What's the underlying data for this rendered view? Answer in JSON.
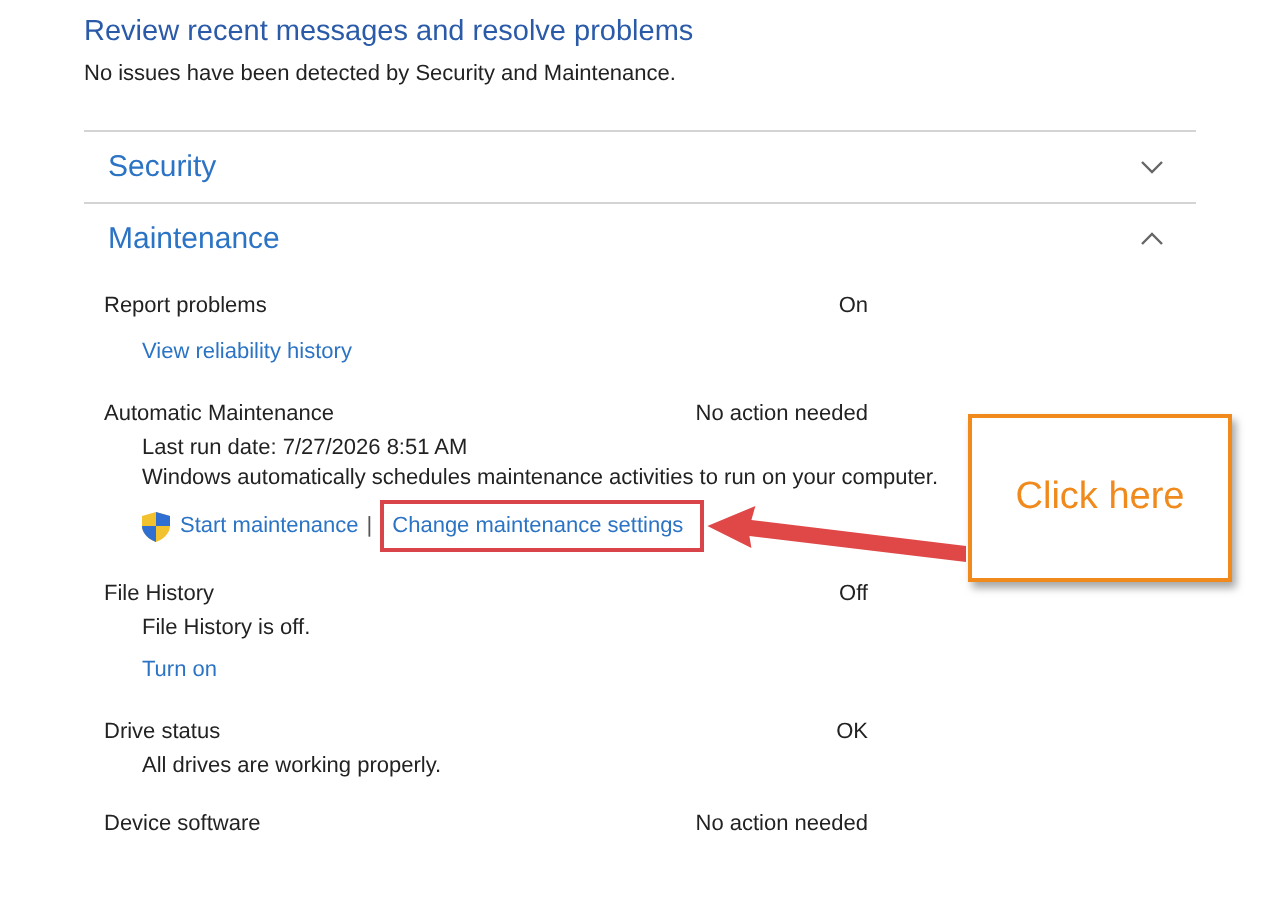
{
  "header": {
    "title": "Review recent messages and resolve problems",
    "subtitle": "No issues have been detected by Security and Maintenance."
  },
  "sections": [
    {
      "title": "Security",
      "expanded": false
    },
    {
      "title": "Maintenance",
      "expanded": true,
      "items": [
        {
          "label": "Report problems",
          "status": "On",
          "actions": [
            {
              "kind": "link",
              "text": "View reliability history",
              "highlighted": false
            }
          ]
        },
        {
          "label": "Automatic Maintenance",
          "status": "No action needed",
          "lines": [
            "Last run date: 7/27/2026 8:51 AM",
            "Windows automatically schedules maintenance activities to run on your computer."
          ],
          "actions": [
            {
              "kind": "shield",
              "text": "Start maintenance",
              "highlighted": false
            },
            {
              "kind": "separator",
              "text": "|",
              "highlighted": false
            },
            {
              "kind": "link",
              "text": "Change maintenance settings",
              "highlighted": true
            }
          ]
        },
        {
          "label": "File History",
          "status": "Off",
          "lines": [
            "File History is off."
          ],
          "actions": [
            {
              "kind": "link",
              "text": "Turn on",
              "highlighted": false
            }
          ]
        },
        {
          "label": "Drive status",
          "status": "OK",
          "lines": [
            "All drives are working properly."
          ]
        },
        {
          "label": "Device software",
          "status": "No action needed"
        }
      ]
    }
  ],
  "callout": {
    "text": "Click here"
  }
}
